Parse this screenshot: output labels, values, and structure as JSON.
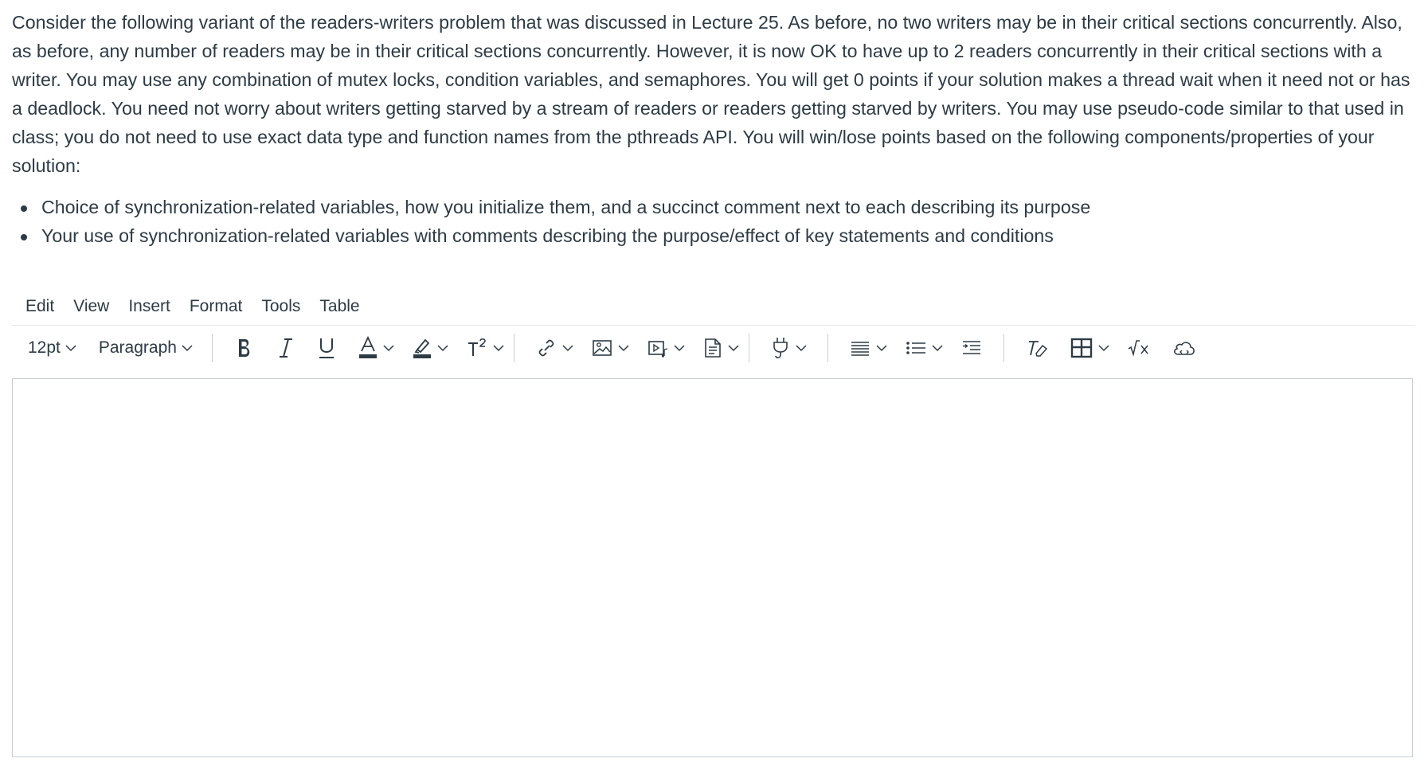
{
  "question": {
    "paragraph": "Consider the following variant of the readers-writers problem that was discussed in Lecture 25. As before, no two writers may be in their critical sections concurrently. Also, as before, any number of readers may be in their critical sections concurrently. However, it is now OK to have up to 2 readers concurrently in their critical sections with a writer. You may use any combination of mutex locks, condition variables, and semaphores. You will get 0 points if your solution makes a thread wait when it need not or has a deadlock. You need not worry about writers getting starved by a stream of readers or readers getting starved by writers. You may use pseudo-code similar to that used in class; you do not need to use exact data type and function names from the pthreads API. You will win/lose points based on the following components/properties of your solution:",
    "bullets": [
      "Choice of synchronization-related variables, how you initialize them, and a succinct comment next to each describing its purpose",
      "Your use of synchronization-related variables with comments describing the purpose/effect of key statements and conditions"
    ]
  },
  "menubar": {
    "items": [
      "Edit",
      "View",
      "Insert",
      "Format",
      "Tools",
      "Table"
    ]
  },
  "toolbar": {
    "font_size": "12pt",
    "block_format": "Paragraph",
    "icons": [
      "bold-icon",
      "italic-icon",
      "underline-icon",
      "text-color-icon",
      "highlight-color-icon",
      "superscript-icon",
      "link-icon",
      "image-icon",
      "media-icon",
      "document-icon",
      "apps-plug-icon",
      "align-icon",
      "list-icon",
      "indent-icon",
      "clear-formatting-icon",
      "table-icon",
      "equation-icon",
      "cloud-embed-icon"
    ]
  },
  "editor": {
    "content": ""
  },
  "colors": {
    "text": "#2d3b45",
    "border": "#c7cdd1",
    "divider": "#e4e6e8"
  }
}
